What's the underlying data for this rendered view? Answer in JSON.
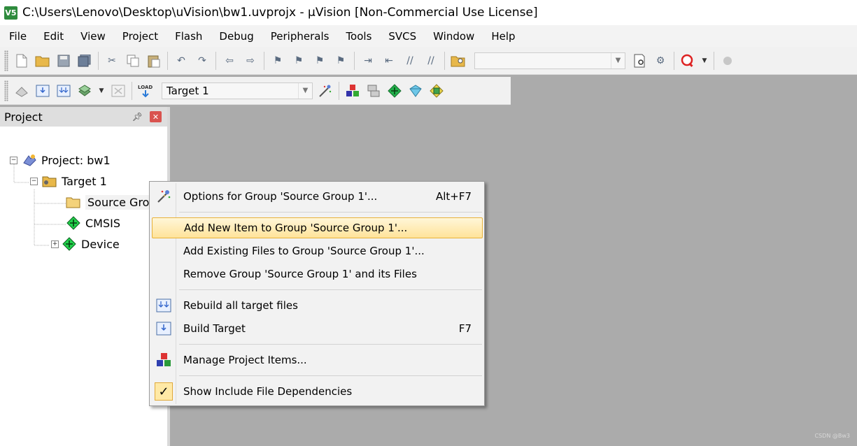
{
  "window": {
    "title": "C:\\Users\\Lenovo\\Desktop\\uVision\\bw1.uvprojx - µVision  [Non-Commercial Use License]",
    "app_icon_text": "V5"
  },
  "menu": [
    "File",
    "Edit",
    "View",
    "Project",
    "Flash",
    "Debug",
    "Peripherals",
    "Tools",
    "SVCS",
    "Window",
    "Help"
  ],
  "toolbar2": {
    "load_label": "LOAD",
    "target_select": "Target 1"
  },
  "project_pane": {
    "title": "Project",
    "tree": {
      "project": "Project: bw1",
      "target": "Target 1",
      "source_group": "Source Grou",
      "cmsis": "CMSIS",
      "device": "Device"
    }
  },
  "context_menu": {
    "items": [
      {
        "label": "Options for Group 'Source Group 1'...",
        "shortcut": "Alt+F7",
        "icon": "magic-wand-icon"
      },
      {
        "label": "Add New  Item to Group 'Source Group 1'...",
        "shortcut": "",
        "icon": ""
      },
      {
        "label": "Add Existing Files to Group 'Source Group 1'...",
        "shortcut": "",
        "icon": ""
      },
      {
        "label": "Remove Group 'Source Group 1' and its Files",
        "shortcut": "",
        "icon": ""
      },
      {
        "label": "Rebuild all target files",
        "shortcut": "",
        "icon": "rebuild-icon"
      },
      {
        "label": "Build Target",
        "shortcut": "F7",
        "icon": "build-icon"
      },
      {
        "label": "Manage Project Items...",
        "shortcut": "",
        "icon": "manage-items-icon"
      },
      {
        "label": "Show Include File Dependencies",
        "shortcut": "",
        "icon": "checkmark-icon"
      }
    ],
    "highlighted_index": 1,
    "checkmark": "✓"
  },
  "watermark": "CSDN @Bw3",
  "colors": {
    "workspace": "#ababab",
    "highlight_border": "#e8b23a",
    "highlight_fill": "#ffe39a",
    "close_button": "#d9534f"
  }
}
